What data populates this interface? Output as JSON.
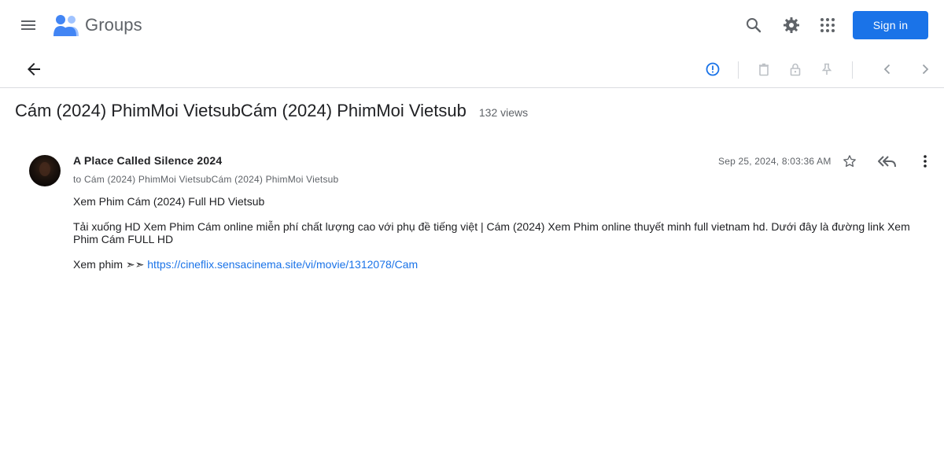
{
  "header": {
    "app_name": "Groups",
    "signin_label": "Sign in"
  },
  "thread": {
    "title": "Cám (2024) PhimMoi VietsubCám (2024) PhimMoi Vietsub",
    "views": "132 views"
  },
  "message": {
    "author": "A Place Called Silence 2024",
    "to_prefix": "to",
    "to_group": "Cám (2024) PhimMoi VietsubCám (2024) PhimMoi Vietsub",
    "date": "Sep 25, 2024, 8:03:36 AM",
    "paragraph1": "Xem Phim Cám (2024) Full HD Vietsub",
    "paragraph2": "Tải xuống HD Xem Phim Cám online miễn phí chất lượng cao với phụ đề tiếng việt | Cám (2024) Xem Phim online thuyết minh full vietnam hd. Dưới đây là đường link Xem Phim Cám FULL HD",
    "paragraph3_prefix": "Xem phim ➣➣",
    "link_text": "https://cineflix.sensacinema.site/vi/movie/1312078/Cam"
  },
  "icons": {
    "menu": "menu-icon",
    "logo": "groups-logo-icon",
    "search": "search-icon",
    "settings": "gear-icon",
    "apps": "apps-grid-icon",
    "back": "arrow-back-icon",
    "report": "report-icon",
    "delete": "trash-icon",
    "lock": "lock-icon",
    "pin": "pin-icon",
    "prev": "chevron-left-icon",
    "next": "chevron-right-icon",
    "star": "star-icon",
    "reply_all": "reply-all-icon",
    "more": "more-vert-icon"
  },
  "colors": {
    "accent": "#1a73e8",
    "text": "#202124",
    "muted": "#5f6368",
    "divider": "#dadce0"
  }
}
